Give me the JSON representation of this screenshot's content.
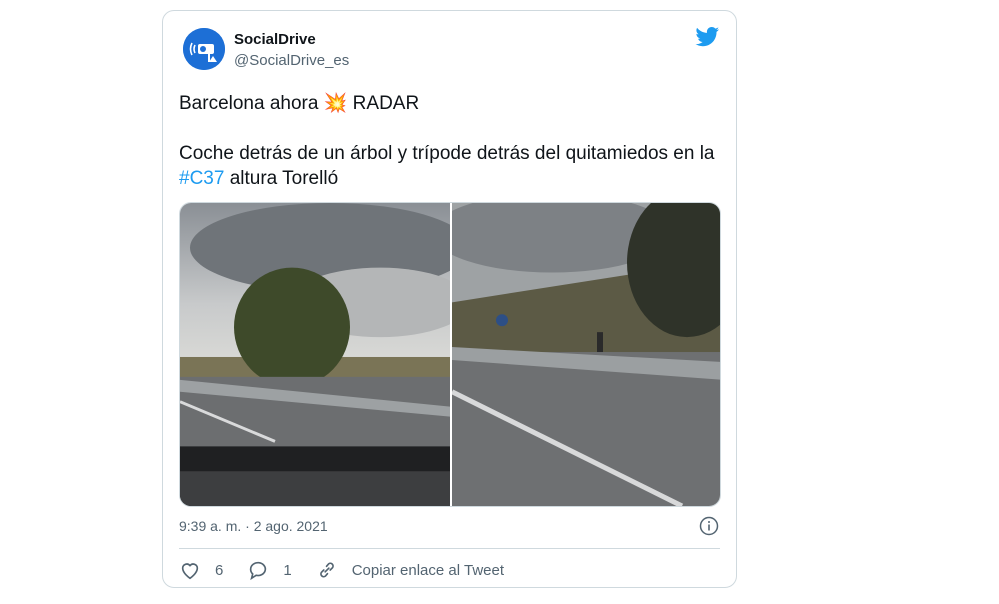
{
  "tweet": {
    "author_name": "SocialDrive",
    "author_handle": "@SocialDrive_es",
    "line1_text": "Barcelona ahora",
    "line1_emoji": "💥",
    "line1_tail": "RADAR",
    "line2_text": "Coche detrás de un árbol y trípode detrás del quitamiedos en la",
    "hashtag": "#C37",
    "line2_tail": "altura Torelló",
    "timestamp": "9:39 a. m. · 2 ago. 2021",
    "like_count": "6",
    "reply_count": "1",
    "copy_link_label": "Copiar enlace al Tweet"
  },
  "colors": {
    "accent": "#1d9bf0",
    "avatar_bg": "#1d6fd6",
    "muted_text": "#536471",
    "border": "#cfd9de"
  },
  "icons": {
    "brand": "twitter-bird-icon",
    "info": "info-icon",
    "like": "heart-icon",
    "reply": "reply-bubble-icon",
    "link": "link-icon"
  }
}
